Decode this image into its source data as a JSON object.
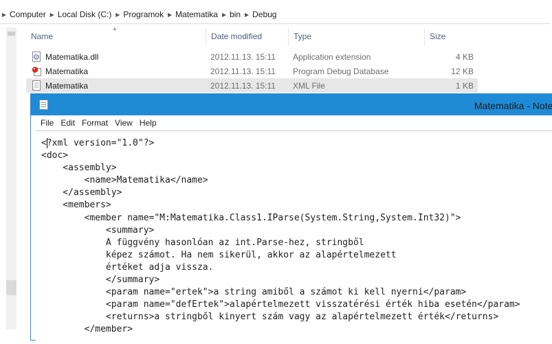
{
  "breadcrumb": [
    "Computer",
    "Local Disk (C:)",
    "Programok",
    "Matematika",
    "bin",
    "Debug"
  ],
  "columns": {
    "name": "Name",
    "date": "Date modified",
    "type": "Type",
    "size": "Size"
  },
  "files": [
    {
      "name": "Matematika.dll",
      "date": "2012.11.13. 15:11",
      "type": "Application extension",
      "size": "4 KB",
      "icon": "dll-file-icon"
    },
    {
      "name": "Matematika",
      "date": "2012.11.13. 15:11",
      "type": "Program Debug Database",
      "size": "12 KB",
      "icon": "pdb-file-icon"
    },
    {
      "name": "Matematika",
      "date": "2012.11.13. 15:11",
      "type": "XML File",
      "size": "1 KB",
      "icon": "xml-file-icon"
    }
  ],
  "notepad": {
    "title": "Matematika - Notepad",
    "menu": [
      "File",
      "Edit",
      "Format",
      "View",
      "Help"
    ],
    "lines": [
      "<?xml version=\"1.0\"?>",
      "<doc>",
      "    <assembly>",
      "        <name>Matematika</name>",
      "    </assembly>",
      "    <members>",
      "        <member name=\"M:Matematika.Class1.IParse(System.String,System.Int32)\">",
      "            <summary>",
      "            A függvény hasonlóan az int.Parse-hez, stringből",
      "            képez számot. Ha nem sikerül, akkor az alapértelmezett",
      "            értéket adja vissza.",
      "            </summary>",
      "            <param name=\"ertek\">a string amiből a számot ki kell nyerni</param>",
      "            <param name=\"defErtek\">alapértelmezett visszatérési érték hiba esetén</param>",
      "            <returns>a stringből kinyert szám vagy az alapértelmezett érték</returns>",
      "        </member>"
    ]
  },
  "colors": {
    "accent": "#1f8bd6",
    "selection": "#e7e7e7",
    "headerText": "#4c607a"
  }
}
